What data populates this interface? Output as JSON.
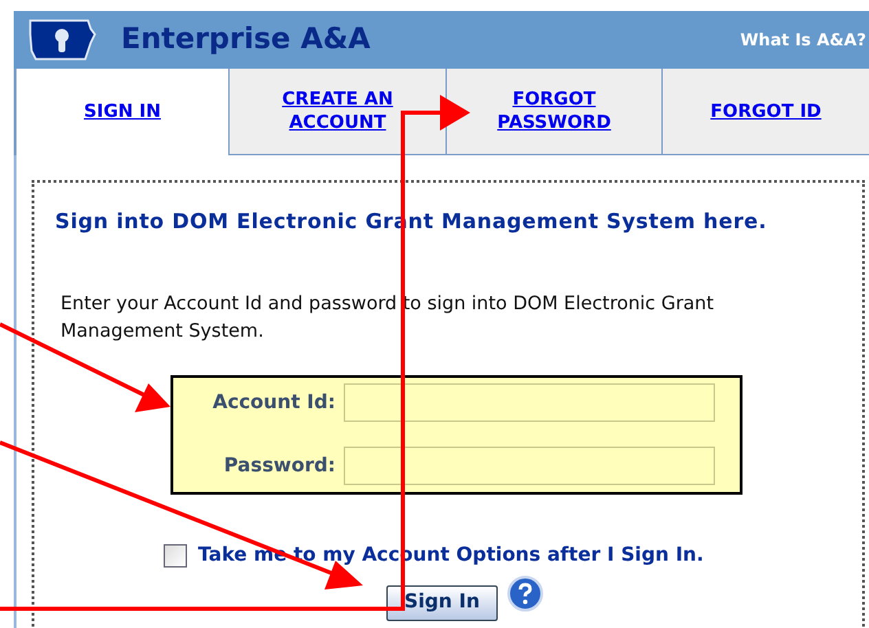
{
  "header": {
    "title": "Enterprise A&A",
    "link": "What Is A&A?"
  },
  "tabs": [
    {
      "label": "SIGN IN",
      "selected": true
    },
    {
      "label": "CREATE AN ACCOUNT",
      "selected": false
    },
    {
      "label": "FORGOT PASSWORD",
      "selected": false
    },
    {
      "label": "FORGOT ID",
      "selected": false
    }
  ],
  "heading": "Sign into DOM Electronic Grant Management System here.",
  "instructions": "Enter your Account Id and password to sign into DOM Electronic Grant Management System.",
  "fields": [
    {
      "label": "Account Id:"
    },
    {
      "label": "Password:"
    }
  ],
  "remember": {
    "label": "Take me to my Account Options after I Sign In.",
    "checked": false
  },
  "submit": "Sign In"
}
